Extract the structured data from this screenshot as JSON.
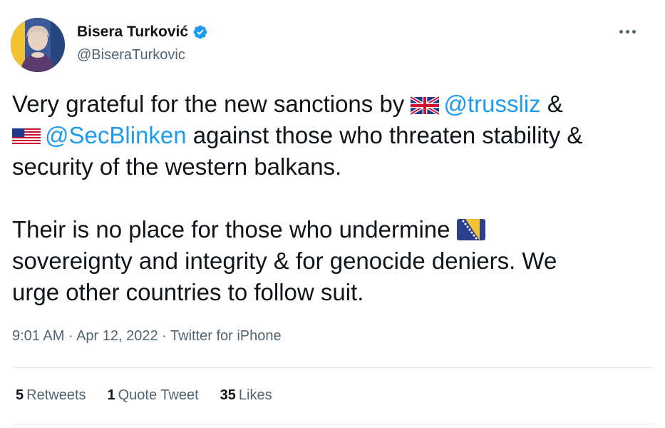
{
  "author": {
    "display_name": "Bisera Turković",
    "handle": "@BiseraTurkovic",
    "verified": true
  },
  "icons": {
    "verified": "verified-badge-icon",
    "more": "more-dots-icon",
    "flag_uk": "flag-uk-icon",
    "flag_us": "flag-us-icon",
    "flag_ba": "flag-ba-icon"
  },
  "tweet": {
    "p1_l1_text": "Very grateful for the new sanctions by",
    "mention1": "@trussliz",
    "amp": " &",
    "mention2": "@SecBlinken",
    "p1_l2_text": " against those who threaten stability &",
    "p1_l3_text": "security of the western balkans.",
    "p2_l1_text": "Their is no place for those who undermine",
    "p2_l2_text": "sovereignty and integrity & for genocide deniers. We",
    "p2_l3_text": "urge other countries to follow suit."
  },
  "meta": {
    "time": "9:01 AM",
    "sep1": " · ",
    "date": "Apr 12, 2022",
    "sep2": " · ",
    "source": "Twitter for iPhone"
  },
  "stats": {
    "retweets_count": "5",
    "retweets_label": "Retweets",
    "quotes_count": "1",
    "quotes_label": "Quote Tweet",
    "likes_count": "35",
    "likes_label": "Likes"
  },
  "colors": {
    "link": "#1d9bf0",
    "secondary_text": "#536471",
    "primary_text": "#0f1419",
    "divider": "#e4e8eb"
  }
}
